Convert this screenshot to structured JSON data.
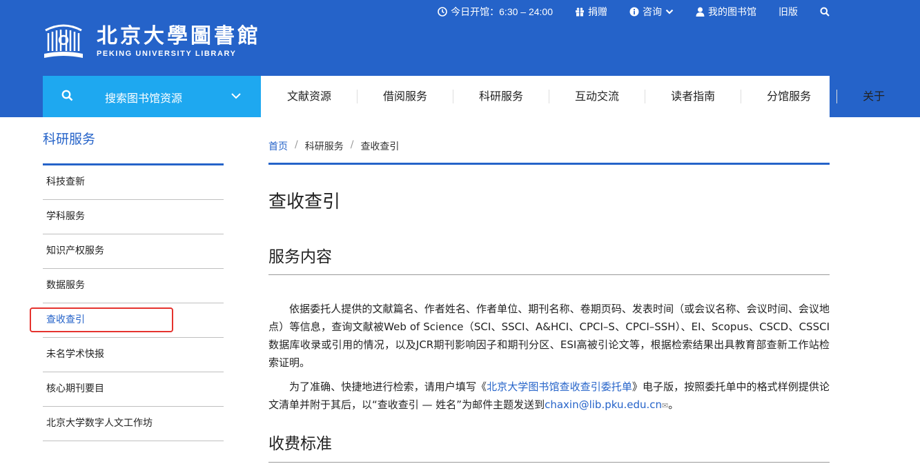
{
  "header": {
    "logo_cn": "北京大學圖書館",
    "logo_en": "PEKING UNIVERSITY LIBRARY",
    "topbar": {
      "hours_label": "今日开馆：6:30 – 24:00",
      "donate_label": "捐赠",
      "consult_label": "咨询",
      "mylib_label": "我的图书馆",
      "old_version_label": "旧版"
    }
  },
  "nav": {
    "search_label": "搜索图书馆资源",
    "items": [
      "文献资源",
      "借阅服务",
      "科研服务",
      "互动交流",
      "读者指南",
      "分馆服务",
      "关于"
    ]
  },
  "sidebar": {
    "title": "科研服务",
    "items": [
      "科技查新",
      "学科服务",
      "知识产权服务",
      "数据服务",
      "查收查引",
      "未名学术快报",
      "核心期刊要目",
      "北京大学数字人文工作坊"
    ],
    "active_index": 4
  },
  "breadcrumb": {
    "home": "首页",
    "sep": "/",
    "level1": "科研服务",
    "current": "查收查引"
  },
  "content": {
    "title": "查收查引",
    "section1_heading": "服务内容",
    "para1": "依据委托人提供的文献篇名、作者姓名、作者单位、期刊名称、卷期页码、发表时间（或会议名称、会议时间、会议地点）等信息，查询文献被Web of Science（SCI、SSCI、A&HCI、CPCI–S、CPCI–SSH）、EI、Scopus、CSCD、CSSCI数据库收录或引用的情况，以及JCR期刊影响因子和期刊分区、ESI高被引论文等，根据检索结果出具教育部查新工作站检索证明。",
    "para2_before": "为了准确、快捷地进行检索，请用户填写《",
    "para2_link": "北京大学图书馆查收查引委托单",
    "para2_middle": "》电子版，按照委托单中的格式样例提供论文清单并附于其后，以“查收查引 — 姓名”为邮件主题发送到",
    "para2_email": "chaxin@lib.pku.edu.cn",
    "para2_end": "。",
    "section2_heading": "收费标准"
  },
  "colors": {
    "brand_blue": "#2563c9",
    "search_blue": "#1ea8f0",
    "highlight_red": "#e5322d"
  }
}
